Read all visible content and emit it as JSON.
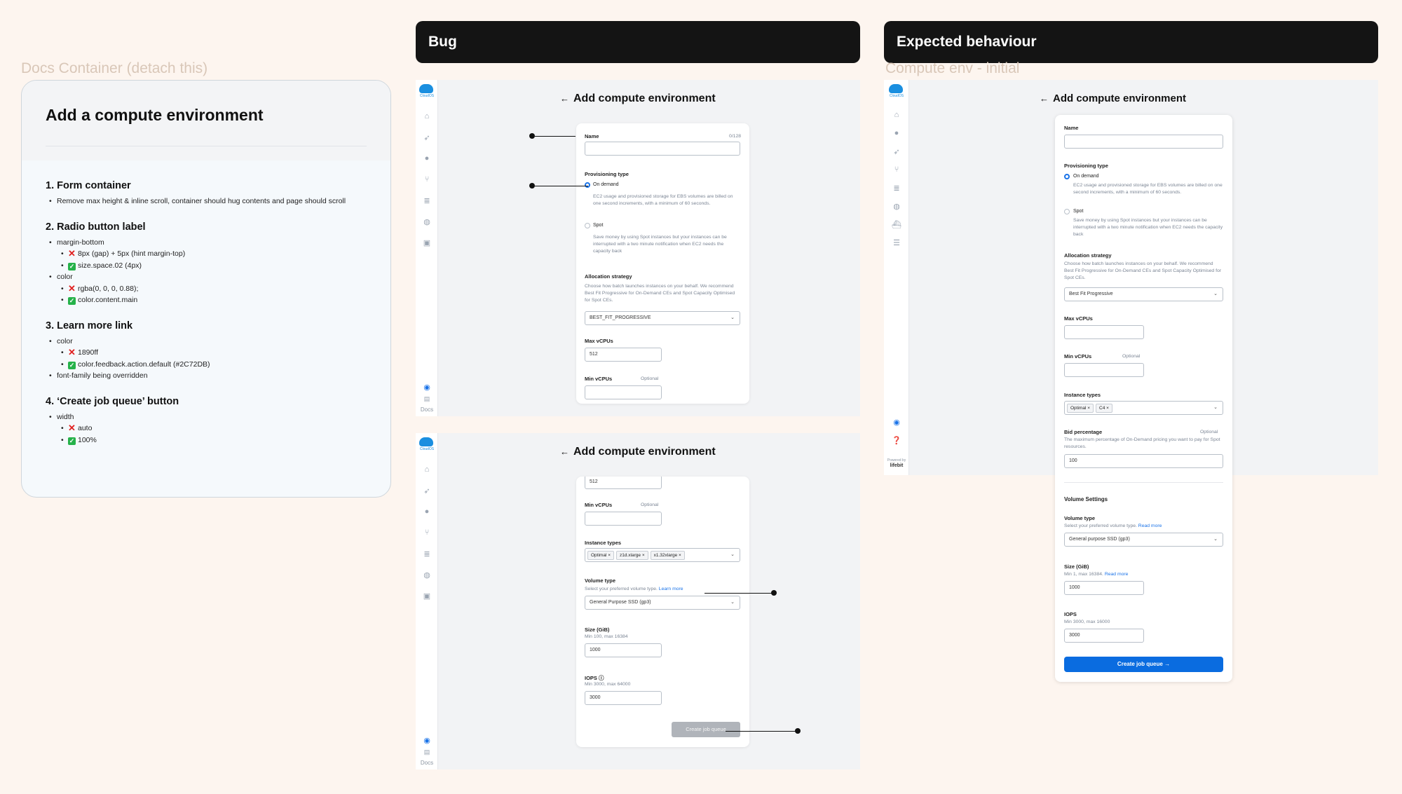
{
  "docs": {
    "caption": "Docs Container (detach this)",
    "title": "Add a compute environment",
    "s1": {
      "title": "1. Form container",
      "items": [
        "Remove max height & inline scroll, container should hug contents and page should scroll"
      ]
    },
    "s2": {
      "title": "2. Radio button label",
      "margin_label": "margin-bottom",
      "margin_bad": "8px (gap) + 5px (hint margin-top)",
      "margin_good": "size.space.02 (4px)",
      "color_label": "color",
      "color_bad": "rgba(0, 0, 0, 0.88);",
      "color_good": "color.content.main"
    },
    "s3": {
      "title": "3. Learn more link",
      "color_label": "color",
      "color_bad": "1890ff",
      "color_good": "color.feedback.action.default (#2C72DB)",
      "font_note": "font-family being overridden"
    },
    "s4": {
      "title": "4. ‘Create job queue’ button",
      "width_label": "width",
      "width_bad": "auto",
      "width_good": "100%"
    }
  },
  "bug": {
    "header": "Bug"
  },
  "expected": {
    "header": "Expected behaviour",
    "caption": "Compute env - initial"
  },
  "app": {
    "logo_text": "CloudOS",
    "docs_label": "Docs",
    "page_title": "Add compute environment",
    "back_arrow": "←",
    "powered_by": "Powered by",
    "powered_brand": "lifebit"
  },
  "bug_top": {
    "name_label": "Name",
    "name_count": "0/128",
    "prov_label": "Provisioning type",
    "on_demand": "On demand",
    "on_demand_hint": "EC2 usage and provisioned storage for EBS volumes are billed on one second increments, with a minimum of 60 seconds.",
    "spot": "Spot",
    "spot_hint": "Save money by using Spot instances but your instances can be interrupted with a two minute notification when EC2 needs the capacity back",
    "alloc_label": "Allocation strategy",
    "alloc_hint": "Choose how batch launches instances on your behalf. We recommend Best Fit Progressive for On-Demand CEs and Spot Capacity Optimised for Spot CEs.",
    "alloc_value": "BEST_FIT_PROGRESSIVE",
    "max_label": "Max vCPUs",
    "max_value": "512",
    "min_label": "Min vCPUs",
    "optional": "Optional"
  },
  "bug_bottom": {
    "max_value": "512",
    "min_label": "Min vCPUs",
    "optional": "Optional",
    "inst_label": "Instance types",
    "chips": [
      "Optimal",
      "z1d.xlarge",
      "x1.32xlarge"
    ],
    "vol_label": "Volume type",
    "vol_hint": "Select your preferred volume type.",
    "learn_more": "Learn more",
    "vol_value": "General Purpose SSD (gp3)",
    "size_label": "Size (GiB)",
    "size_hint": "Min 100, max 16384",
    "size_value": "1000",
    "iops_label": "IOPS",
    "iops_hint": "Min 3000, max 64000",
    "iops_value": "3000",
    "create_btn": "Create job queue"
  },
  "exp_form": {
    "name_label": "Name",
    "prov_label": "Provisioning type",
    "on_demand": "On demand",
    "on_demand_hint": "EC2 usage and provisioned storage for EBS volumes are billed on one second increments, with a minimum of 60 seconds.",
    "spot": "Spot",
    "spot_hint": "Save money by using Spot instances but your instances can be interrupted with a two minute notification when EC2 needs the capacity back",
    "alloc_label": "Allocation strategy",
    "alloc_hint": "Choose how batch launches instances on your behalf. We recommend Best Fit Progressive for On-Demand CEs and Spot Capacity Optimised for Spot CEs.",
    "alloc_value": "Best Fit Progressive",
    "max_label": "Max vCPUs",
    "min_label": "Min vCPUs",
    "optional": "Optional",
    "inst_label": "Instance types",
    "chips": [
      "Optimal",
      "C4"
    ],
    "bid_label": "Bid percentage",
    "bid_hint": "The maximum percentage of On-Demand pricing you want to pay for Spot resources.",
    "bid_value": "100",
    "vol_settings": "Volume Settings",
    "vol_label": "Volume type",
    "vol_hint": "Select your preferred volume type.",
    "read_more": "Read more",
    "vol_value": "General purpose SSD (gp3)",
    "size_label": "Size (GiB)",
    "size_hint": "Min 1, max 16384.",
    "size_value": "1000",
    "iops_label": "IOPS",
    "iops_hint": "Min 3000, max 16000",
    "iops_value": "3000",
    "create_btn": "Create job queue",
    "create_arrow": "→"
  },
  "callouts": {
    "marker": "•"
  }
}
